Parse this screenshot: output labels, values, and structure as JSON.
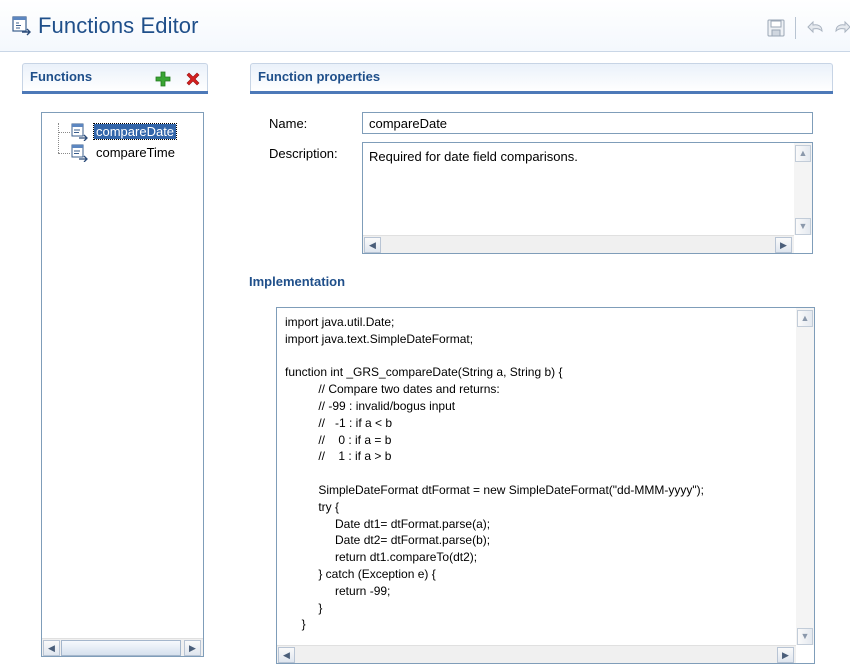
{
  "window": {
    "title": "Functions Editor",
    "title_icon": "functions-editor-icon",
    "toolbar_icons": [
      "save-icon",
      "undo-icon",
      "redo-icon"
    ]
  },
  "functions_panel": {
    "title": "Functions",
    "add_icon": "add-icon",
    "delete_icon": "delete-icon",
    "items": [
      {
        "label": "compareDate",
        "selected": true
      },
      {
        "label": "compareTime",
        "selected": false
      }
    ]
  },
  "properties_panel": {
    "title": "Function properties",
    "name_label": "Name:",
    "name_value": "compareDate",
    "description_label": "Description:",
    "description_value": "Required for date field comparisons."
  },
  "implementation": {
    "title": "Implementation",
    "code": "import java.util.Date;\nimport java.text.SimpleDateFormat;\n\nfunction int _GRS_compareDate(String a, String b) {\n          // Compare two dates and returns:\n          // -99 : invalid/bogus input\n          //   -1 : if a < b\n          //    0 : if a = b\n          //    1 : if a > b\n\n          SimpleDateFormat dtFormat = new SimpleDateFormat(\"dd-MMM-yyyy\");\n          try {\n               Date dt1= dtFormat.parse(a);\n               Date dt2= dtFormat.parse(b);\n               return dt1.compareTo(dt2);\n          } catch (Exception e) {\n               return -99;\n          }\n     }"
  },
  "colors": {
    "title": "#1f4f8a",
    "section_accent": "#4d79b8",
    "selection": "#3366aa",
    "add_green": "#3aa534",
    "delete_red": "#d42020"
  }
}
